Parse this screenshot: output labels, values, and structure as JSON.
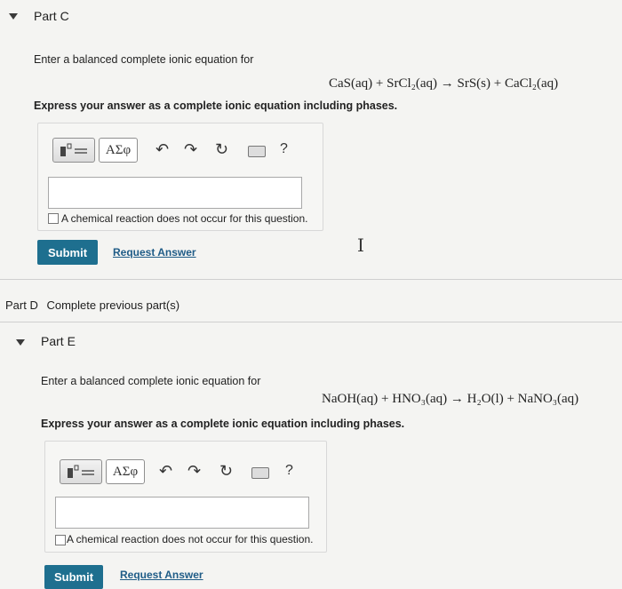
{
  "part_c": {
    "title": "Part C",
    "prompt": "Enter a balanced complete ionic equation for",
    "equation": "CaS(aq) + SrCl₂(aq) → SrS(s) + CaCl₂(aq)",
    "instruction": "Express your answer as a complete ionic equation including phases.",
    "toolbar": {
      "greek_label": "ΑΣφ",
      "help_label": "?"
    },
    "answer_value": "",
    "checkbox_label": "A chemical reaction does not occur for this question.",
    "submit_label": "Submit",
    "request_label": "Request Answer"
  },
  "part_d": {
    "title": "Part D",
    "status": "Complete previous part(s)"
  },
  "part_e": {
    "title": "Part E",
    "prompt": "Enter a balanced complete ionic equation for",
    "equation": "NaOH(aq) + HNO₃(aq) → H₂O(l) + NaNO₃(aq)",
    "instruction": "Express your answer as a complete ionic equation including phases.",
    "toolbar": {
      "greek_label": "ΑΣφ",
      "help_label": "?"
    },
    "answer_value": "",
    "checkbox_label": "A chemical reaction does not occur for this question.",
    "submit_label": "Submit",
    "request_label": "Request Answer"
  },
  "colors": {
    "submit_bg": "#1e6f8f",
    "link": "#1f5c87"
  }
}
